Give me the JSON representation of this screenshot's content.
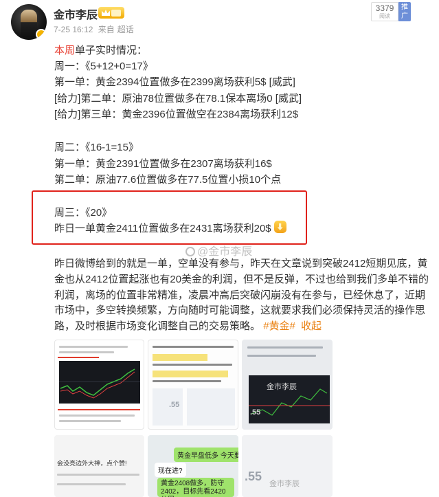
{
  "header": {
    "author": "金市李辰",
    "time": "7-25 16:12",
    "source_prefix": "来自",
    "source": "超话",
    "read_count": "3379",
    "read_label": "阅读",
    "promote_label": "推广"
  },
  "post": {
    "intro_hl": "本周",
    "intro_rest": "单子实时情况：",
    "mon_title": "周一：《5+12+0=17》",
    "mon_1": "第一单：黄金2394位置做多在2399离场获利5$ [威武]",
    "mon_2": "[给力]第二单：原油78位置做多在78.1保本离场0 [威武]",
    "mon_3": "[给力]第三单：黄金2396位置做空在2384离场获利12$",
    "tue_title": "周二：《16-1=15》",
    "tue_1": "第一单：黄金2391位置做多在2307离场获利16$",
    "tue_2": "第二单：原油77.6位置做多在77.5位置小损10个点",
    "wed_title": "周三：《20》",
    "wed_1": "昨日一单黄金2411位置做多在2431离场获利20$",
    "watermark": "金市李辰",
    "paragraph": "昨日微博给到的就是一单，空单没有参与，昨天在文章说到突破2412短期见底，黄金也从2412位置起涨也有20美金的利润，但不是反弹，不过也给到我们多单不错的利润，离场的位置非常精准，凌晨冲高后突破闪崩没有在参与，已经休息了，近期市场中，多空转换频繁，方向随时可能调整，这就要求我们必须保持灵活的操作思路，及时根据市场变化调整自己的交易策略。",
    "tag": "#黄金#",
    "collapse": "收起"
  },
  "images": {
    "im3_watermark": "金市李辰",
    "im3_num": ".55",
    "im2_num": ".55",
    "im4_text": "会没亮边外大神，点个赞!",
    "im5_chat1": "黄金早盘低多  今天要强",
    "im5_chat2": "现在进?",
    "im5_chat3": "黄金2408做多，防守2402，目标先看2420位置",
    "im6_num": ".55",
    "im6_watermark": "金市李辰"
  },
  "colors": {
    "highlight": "#e8463a",
    "link": "#ea8010",
    "frame": "#e0221b"
  }
}
